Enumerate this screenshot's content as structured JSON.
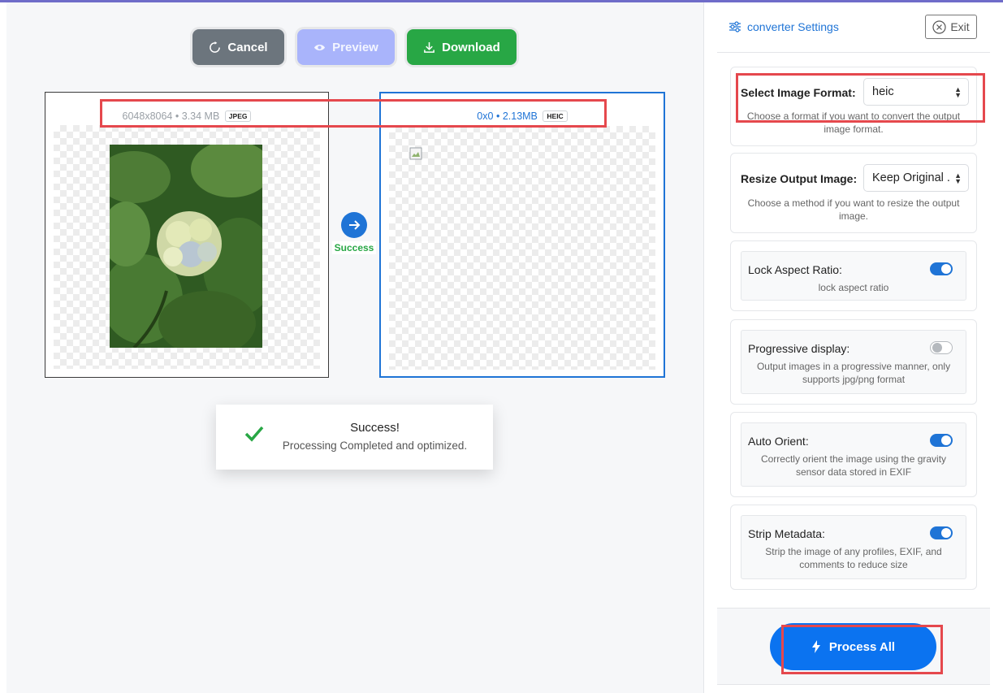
{
  "toolbar": {
    "cancel_label": "Cancel",
    "preview_label": "Preview",
    "download_label": "Download"
  },
  "source": {
    "dimensions": "6048x8064",
    "separator": "•",
    "size": "3.34 MB",
    "format": "JPEG"
  },
  "output": {
    "dimensions": "0x0",
    "separator": "•",
    "size": "2.13MB",
    "format": "HEIC"
  },
  "status": {
    "label": "Success"
  },
  "toast": {
    "title": "Success!",
    "message": "Processing Completed and optimized."
  },
  "sidebar": {
    "title": "converter Settings",
    "exit_label": "Exit",
    "format": {
      "label": "Select Image Format:",
      "value": "heic",
      "hint": "Choose a format if you want to convert the output image format."
    },
    "resize": {
      "label": "Resize Output Image:",
      "value": "Keep Original .",
      "hint": "Choose a method if you want to resize the output image."
    },
    "toggles": [
      {
        "label": "Lock Aspect Ratio:",
        "desc": "lock aspect ratio",
        "on": true
      },
      {
        "label": "Progressive display:",
        "desc": "Output images in a progressive manner, only supports jpg/png format",
        "on": false
      },
      {
        "label": "Auto Orient:",
        "desc": "Correctly orient the image using the gravity sensor data stored in EXIF",
        "on": true
      },
      {
        "label": "Strip Metadata:",
        "desc": "Strip the image of any profiles, EXIF, and comments to reduce size",
        "on": true
      }
    ],
    "process_label": "Process All"
  },
  "colors": {
    "accent": "#1f74d6",
    "success": "#28a745",
    "highlight": "#e5484d"
  }
}
